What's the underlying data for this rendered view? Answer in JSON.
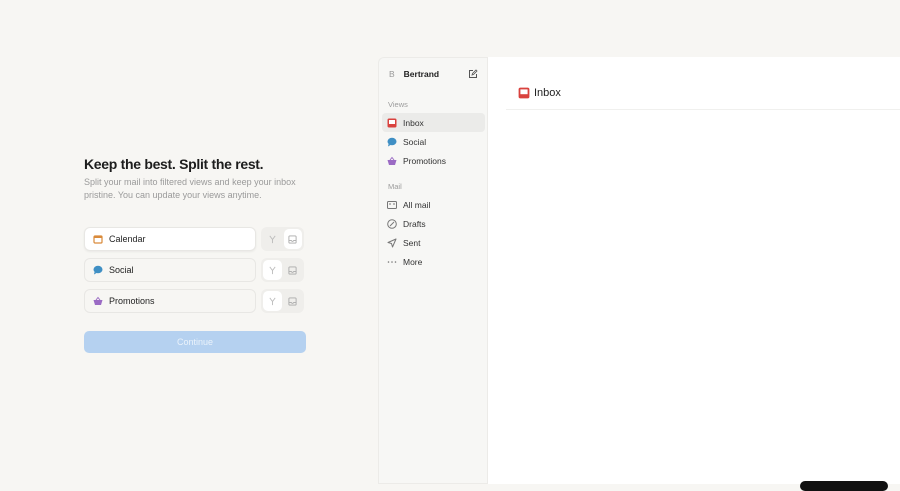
{
  "onboarding": {
    "title": "Keep the best. Split the rest.",
    "subtitle": "Split your mail into filtered views and keep your inbox pristine. You can update your views anytime.",
    "views": [
      {
        "label": "Calendar",
        "icon": "calendar-icon"
      },
      {
        "label": "Social",
        "icon": "chat-bubble-icon"
      },
      {
        "label": "Promotions",
        "icon": "basket-icon"
      }
    ],
    "continue_label": "Continue"
  },
  "sidebar": {
    "avatar_initial": "B",
    "user_name": "Bertrand",
    "views_heading": "Views",
    "views": [
      {
        "label": "Inbox"
      },
      {
        "label": "Social"
      },
      {
        "label": "Promotions"
      }
    ],
    "mail_heading": "Mail",
    "mail": [
      {
        "label": "All mail"
      },
      {
        "label": "Drafts"
      },
      {
        "label": "Sent"
      },
      {
        "label": "More"
      }
    ]
  },
  "main": {
    "title": "Inbox"
  },
  "colors": {
    "accent": "#b5d1f0",
    "inbox": "#d9423e",
    "social": "#3f8fc4",
    "promotions": "#9b6bc4",
    "calendar": "#d98a3a"
  }
}
